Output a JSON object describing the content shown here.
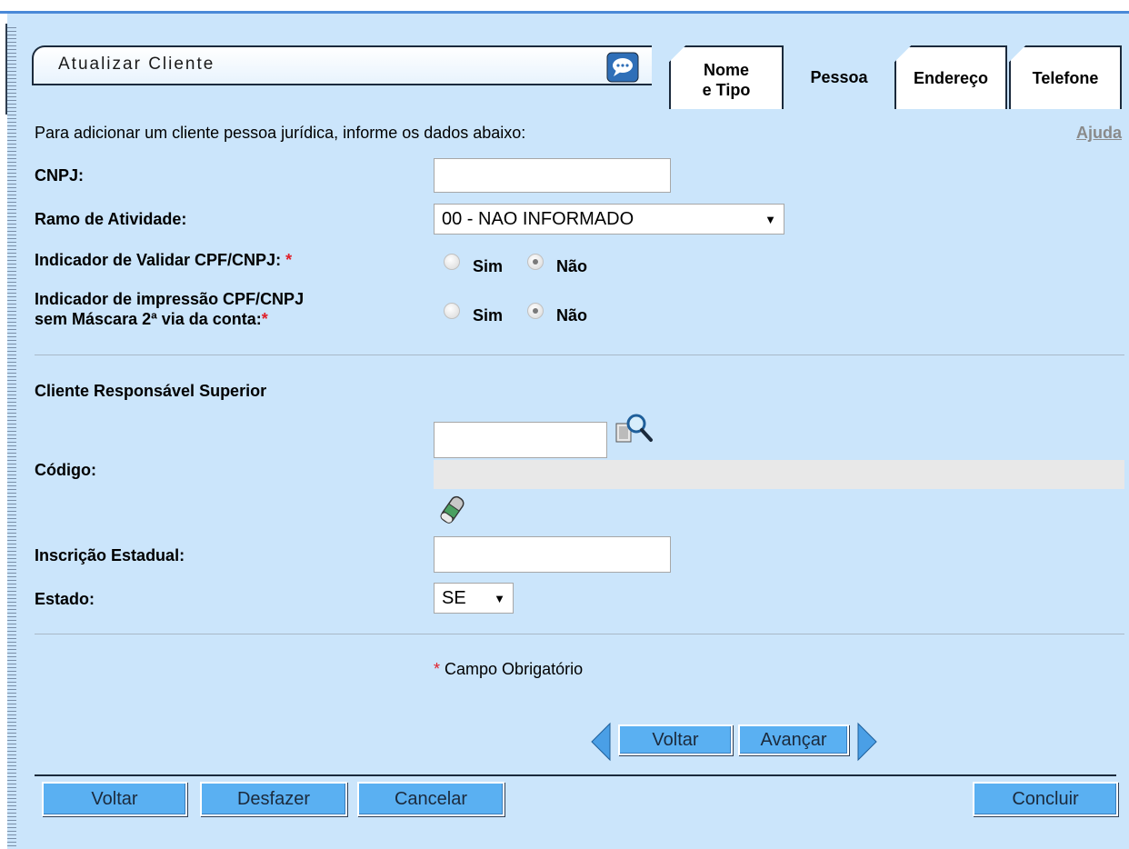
{
  "title": "Atualizar Cliente",
  "tabs": [
    {
      "label": "Nome\ne Tipo",
      "active": false
    },
    {
      "label": "Pessoa",
      "active": true
    },
    {
      "label": "Endereço",
      "active": false
    },
    {
      "label": "Telefone",
      "active": false
    }
  ],
  "intro_text": "Para adicionar um cliente pessoa jurídica, informe os dados abaixo:",
  "help_link": "Ajuda",
  "form": {
    "cnpj_label": "CNPJ:",
    "cnpj_value": "",
    "ramo_label": "Ramo de Atividade:",
    "ramo_selected": "00 - NAO INFORMADO",
    "validar_label": "Indicador de Validar CPF/CNPJ:",
    "validar_sim": "Sim",
    "validar_nao": "Não",
    "validar_selected": "Não",
    "impressao_label_line1": "Indicador de impressão CPF/CNPJ",
    "impressao_label_line2": "sem Máscara 2ª via da conta:",
    "impressao_sim": "Sim",
    "impressao_nao": "Não",
    "impressao_selected": "Não",
    "required_mark": "*"
  },
  "responsavel": {
    "section_title": "Cliente Responsável Superior",
    "codigo_label": "Código:",
    "codigo_value": "",
    "inscricao_label": "Inscrição Estadual:",
    "inscricao_value": "",
    "estado_label": "Estado:",
    "estado_selected": "SE"
  },
  "required_note": "Campo Obrigatório",
  "navigation": {
    "voltar": "Voltar",
    "avancar": "Avançar"
  },
  "footer_buttons": {
    "voltar": "Voltar",
    "desfazer": "Desfazer",
    "cancelar": "Cancelar",
    "concluir": "Concluir"
  },
  "colors": {
    "background": "#cbe5fb",
    "button": "#5ab0f2",
    "required": "#e0202a",
    "border_dark": "#1b2a3c"
  }
}
